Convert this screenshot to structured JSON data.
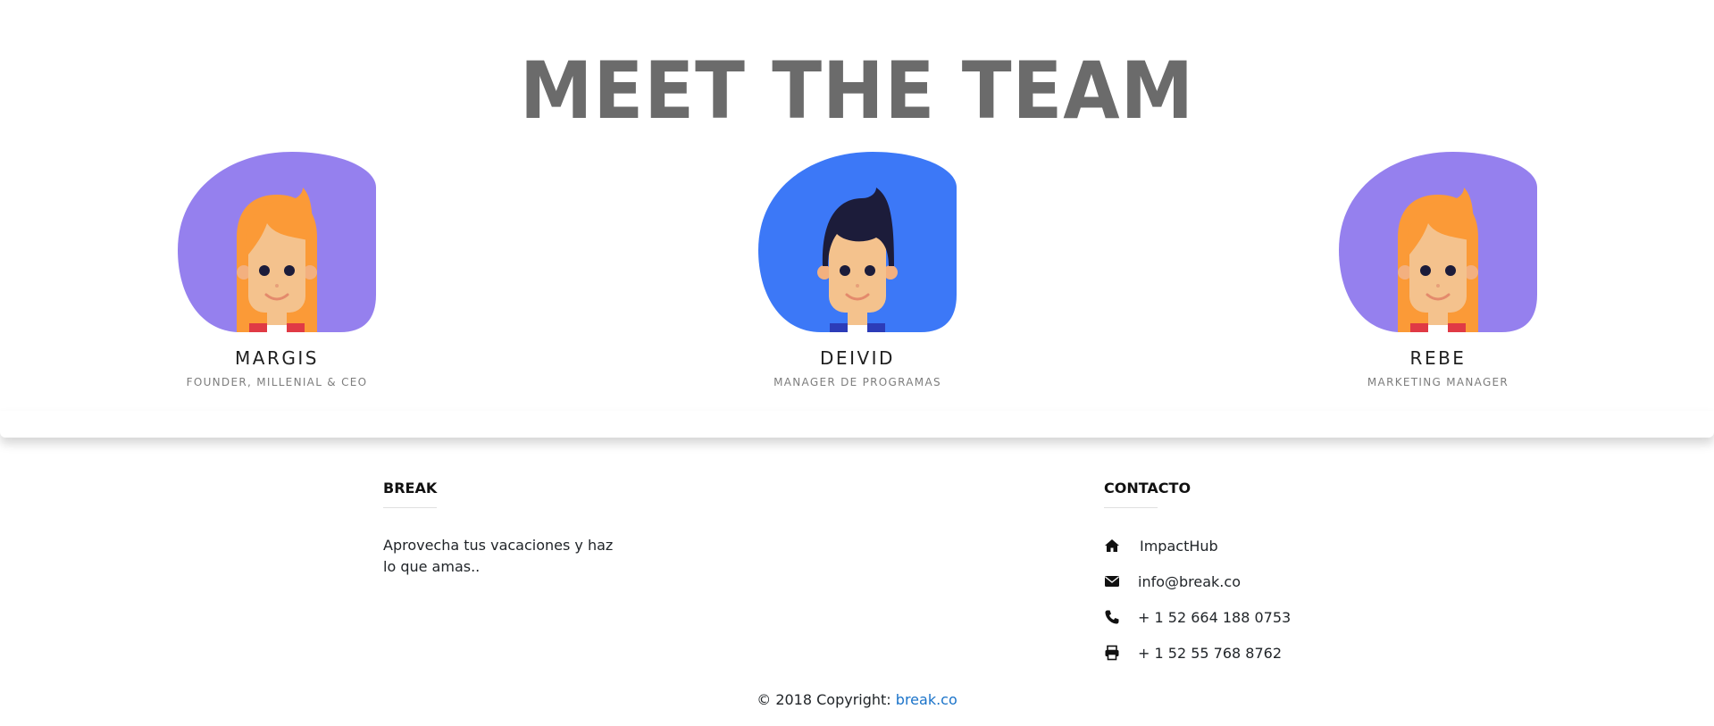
{
  "section": {
    "title": "MEET THE TEAM"
  },
  "team": [
    {
      "name": "MARGIS",
      "role": "FOUNDER, MILLENIAL & CEO",
      "avatar": "female-avatar-icon",
      "bg_color": "#9580ee"
    },
    {
      "name": "DEIVID",
      "role": "MANAGER DE PROGRAMAS",
      "avatar": "male-avatar-icon",
      "bg_color": "#3c78f7"
    },
    {
      "name": "REBE",
      "role": "MARKETING MANAGER",
      "avatar": "female-avatar-icon",
      "bg_color": "#9580ee"
    }
  ],
  "footer": {
    "brand": {
      "heading": "BREAK",
      "text": "Aprovecha tus vacaciones y haz lo que amas.."
    },
    "contact": {
      "heading": "CONTACTO",
      "items": [
        {
          "icon": "home-icon",
          "text": "ImpactHub"
        },
        {
          "icon": "envelope-icon",
          "text": "info@break.co"
        },
        {
          "icon": "phone-icon",
          "text": "+ 1 52 664 188 0753"
        },
        {
          "icon": "printer-icon",
          "text": "+ 1 52 55 768 8762"
        }
      ]
    },
    "copyright": {
      "prefix": "© 2018 Copyright:",
      "link_text": "break.co"
    }
  },
  "colors": {
    "link": "#1a73c9",
    "title": "#6b6b6b"
  }
}
